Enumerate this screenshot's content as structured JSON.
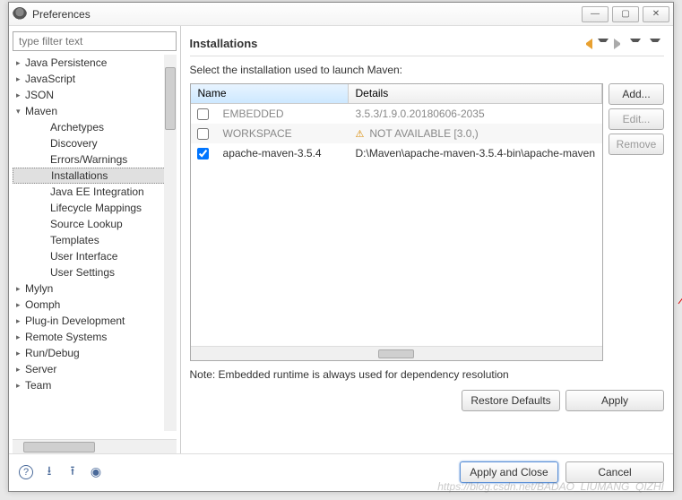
{
  "window": {
    "title": "Preferences"
  },
  "filter": {
    "placeholder": "type filter text"
  },
  "tree": {
    "items": [
      {
        "label": "Java Persistence",
        "expandable": true,
        "expanded": false,
        "level": 0
      },
      {
        "label": "JavaScript",
        "expandable": true,
        "expanded": false,
        "level": 0
      },
      {
        "label": "JSON",
        "expandable": true,
        "expanded": false,
        "level": 0
      },
      {
        "label": "Maven",
        "expandable": true,
        "expanded": true,
        "level": 0
      },
      {
        "label": "Archetypes",
        "expandable": false,
        "level": 1
      },
      {
        "label": "Discovery",
        "expandable": false,
        "level": 1
      },
      {
        "label": "Errors/Warnings",
        "expandable": false,
        "level": 1
      },
      {
        "label": "Installations",
        "expandable": false,
        "level": 1,
        "selected": true
      },
      {
        "label": "Java EE Integration",
        "expandable": false,
        "level": 1
      },
      {
        "label": "Lifecycle Mappings",
        "expandable": false,
        "level": 1
      },
      {
        "label": "Source Lookup",
        "expandable": false,
        "level": 1
      },
      {
        "label": "Templates",
        "expandable": false,
        "level": 1
      },
      {
        "label": "User Interface",
        "expandable": false,
        "level": 1
      },
      {
        "label": "User Settings",
        "expandable": false,
        "level": 1
      },
      {
        "label": "Mylyn",
        "expandable": true,
        "expanded": false,
        "level": 0
      },
      {
        "label": "Oomph",
        "expandable": true,
        "expanded": false,
        "level": 0
      },
      {
        "label": "Plug-in Development",
        "expandable": true,
        "expanded": false,
        "level": 0
      },
      {
        "label": "Remote Systems",
        "expandable": true,
        "expanded": false,
        "level": 0
      },
      {
        "label": "Run/Debug",
        "expandable": true,
        "expanded": false,
        "level": 0
      },
      {
        "label": "Server",
        "expandable": true,
        "expanded": false,
        "level": 0
      },
      {
        "label": "Team",
        "expandable": true,
        "expanded": false,
        "level": 0
      }
    ]
  },
  "page": {
    "title": "Installations",
    "description": "Select the installation used to launch Maven:",
    "columns": {
      "name": "Name",
      "details": "Details"
    },
    "rows": [
      {
        "checked": false,
        "disabled": true,
        "name": "EMBEDDED",
        "details": "3.5.3/1.9.0.20180606-2035",
        "warn": false
      },
      {
        "checked": false,
        "disabled": true,
        "name": "WORKSPACE",
        "details": "NOT AVAILABLE [3.0,)",
        "warn": true
      },
      {
        "checked": true,
        "disabled": false,
        "name": "apache-maven-3.5.4",
        "details": "D:\\Maven\\apache-maven-3.5.4-bin\\apache-maven",
        "warn": false
      }
    ],
    "buttons": {
      "add": "Add...",
      "edit": "Edit...",
      "remove": "Remove"
    },
    "note": "Note: Embedded runtime is always used for dependency resolution",
    "restore": "Restore Defaults",
    "apply": "Apply"
  },
  "bottom": {
    "apply_close": "Apply and Close",
    "cancel": "Cancel"
  },
  "watermark": "https://blog.csdn.net/BADAO_LIUMANG_QIZHI"
}
